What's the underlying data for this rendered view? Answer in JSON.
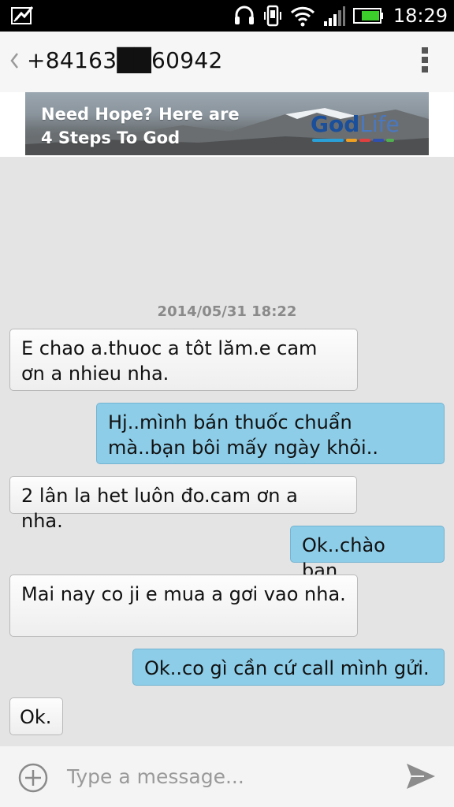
{
  "status_bar": {
    "time": "18:29",
    "icons": [
      "notification-icon",
      "headset-icon",
      "phone-vibrate-icon",
      "wifi-icon",
      "signal-icon",
      "battery-icon"
    ]
  },
  "header": {
    "contact": "+84163██60942"
  },
  "ad": {
    "line1": "Need Hope? Here are",
    "line2": "4 Steps To God",
    "brand_main": "God",
    "brand_light": "Life"
  },
  "conversation": {
    "timestamp": "2014/05/31 18:22",
    "messages": [
      {
        "direction": "received",
        "text": "E chao a.thuoc a tôt lăm.e cam ơn a nhieu nha."
      },
      {
        "direction": "sent",
        "text": "Hj..mình bán thuốc chuẩn mà..bạn bôi mấy ngày khỏi.."
      },
      {
        "direction": "received",
        "text": "2 lân la het luôn đo.cam ơn a nha."
      },
      {
        "direction": "sent",
        "text": "Ok..chào bạn."
      },
      {
        "direction": "received",
        "text": "Mai nay co ji e mua a gơi vao nha."
      },
      {
        "direction": "sent",
        "text": "Ok..co gì cần cứ call mình gửi."
      },
      {
        "direction": "received",
        "text": "Ok."
      }
    ]
  },
  "composer": {
    "placeholder": "Type a message..."
  },
  "colors": {
    "sent_bubble": "#8dcde8",
    "received_bubble": "#f2f2f2",
    "background": "#e4e4e4"
  }
}
